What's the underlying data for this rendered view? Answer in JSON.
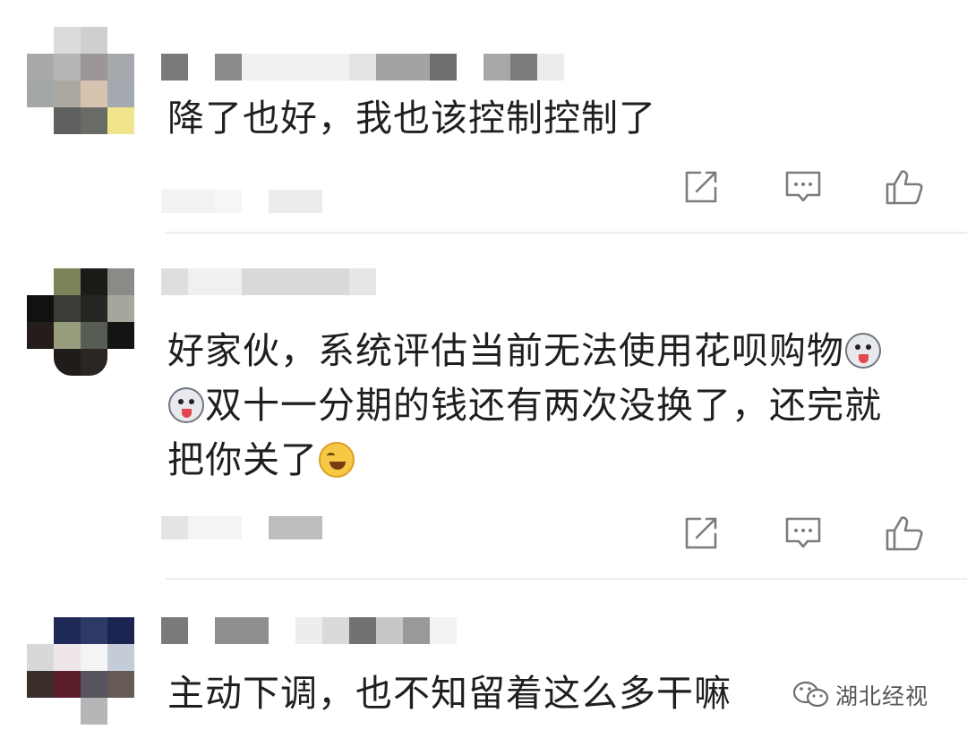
{
  "comments": [
    {
      "text": "降了也好，我也该控制控制了",
      "avatar": "avatar-1",
      "actions": [
        "share-icon",
        "reply-icon",
        "like-icon"
      ]
    },
    {
      "text_line_1": "好家伙，系统评估当前无法使用花呗购物",
      "text_line_2": "双十一分期的钱还有两次没换了，还完就",
      "text_line_3": "把你关了",
      "emoji": [
        "dog-emoji",
        "dog-emoji",
        "laugh-cry-emoji"
      ],
      "avatar": "avatar-2",
      "actions": [
        "share-icon",
        "reply-icon",
        "like-icon"
      ]
    },
    {
      "text": "主动下调，也不知留着这么多干嘛",
      "avatar": "avatar-3"
    }
  ],
  "watermark": {
    "icon": "wechat-icon",
    "text": "湖北经视"
  },
  "colors": {
    "text": "#1f1f1f",
    "icon_stroke": "#7c7c7c",
    "divider": "#ededed",
    "background": "#ffffff"
  }
}
